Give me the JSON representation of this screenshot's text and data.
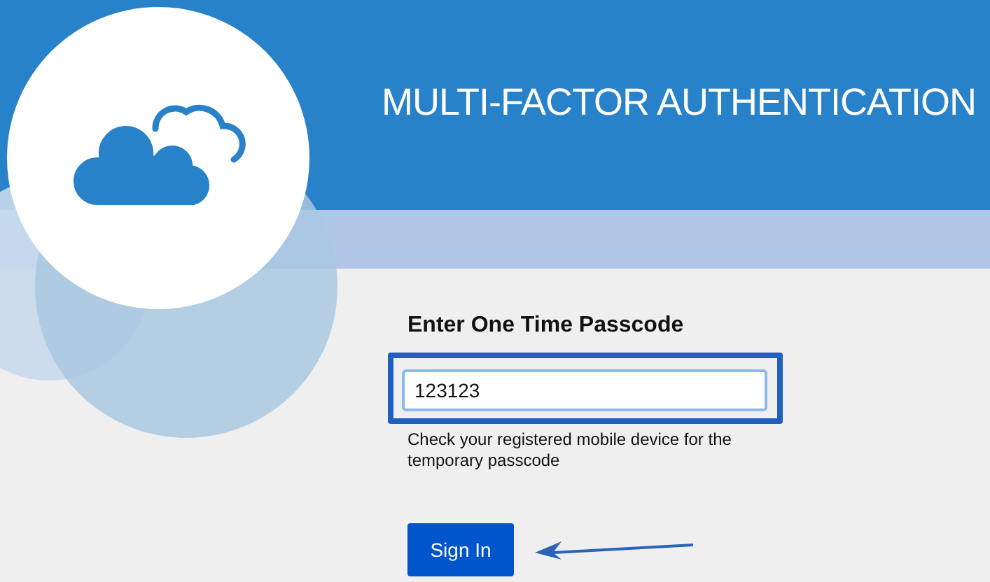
{
  "header": {
    "title": "MULTI-FACTOR AUTHENTICATION"
  },
  "form": {
    "heading": "Enter One Time Passcode",
    "passcode": {
      "value": "123123"
    },
    "help": "Check your registered mobile device for the temporary passcode",
    "button": "Sign In"
  }
}
